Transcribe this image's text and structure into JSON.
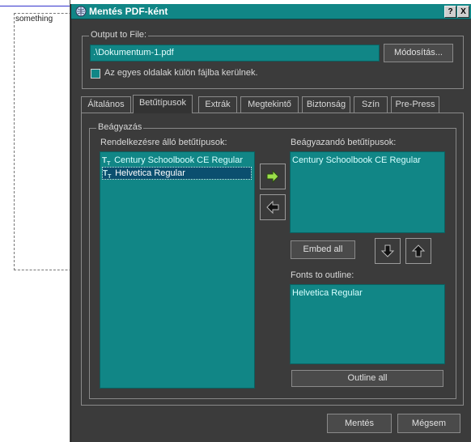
{
  "background": {
    "placeholder_text": "something"
  },
  "dialog": {
    "title": "Mentés PDF-ként",
    "titlebar_buttons": {
      "help": "?",
      "close": "X"
    },
    "output": {
      "group_label": "Output to File:",
      "file_value": ".\\Dokumentum-1.pdf",
      "modify_label": "Módosítás...",
      "separate_pages_label": "Az egyes oldalak külön fájlba kerülnek."
    },
    "tabs": [
      {
        "label": "Általános"
      },
      {
        "label": "Betűtípusok"
      },
      {
        "label": "Extrák"
      },
      {
        "label": "Megtekintő"
      },
      {
        "label": "Biztonság"
      },
      {
        "label": "Szín"
      },
      {
        "label": "Pre-Press"
      }
    ],
    "active_tab": "Betűtípusok",
    "embedding": {
      "group_label": "Beágyazás",
      "available_label": "Rendelkezésre álló betűtípusok:",
      "available_fonts": [
        "Century Schoolbook CE Regular",
        "Helvetica Regular"
      ],
      "selected_available": "Helvetica Regular",
      "to_embed_label": "Beágyazandó betűtípusok:",
      "embed_fonts": [
        "Century Schoolbook CE Regular"
      ],
      "embed_all_label": "Embed all",
      "outline_label": "Fonts to outline:",
      "outline_fonts": [
        "Helvetica Regular"
      ],
      "outline_all_label": "Outline all"
    },
    "footer": {
      "ok_label": "Mentés",
      "cancel_label": "Mégsem"
    },
    "colors": {
      "accent_teal": "#118686",
      "window_bg": "#3b3b3b"
    },
    "icons": {
      "add_arrow": "right-arrow-icon",
      "remove_arrow": "left-arrow-icon",
      "move_down": "down-arrow-icon",
      "move_up": "up-arrow-icon",
      "font_type": "truetype-font-icon"
    }
  }
}
